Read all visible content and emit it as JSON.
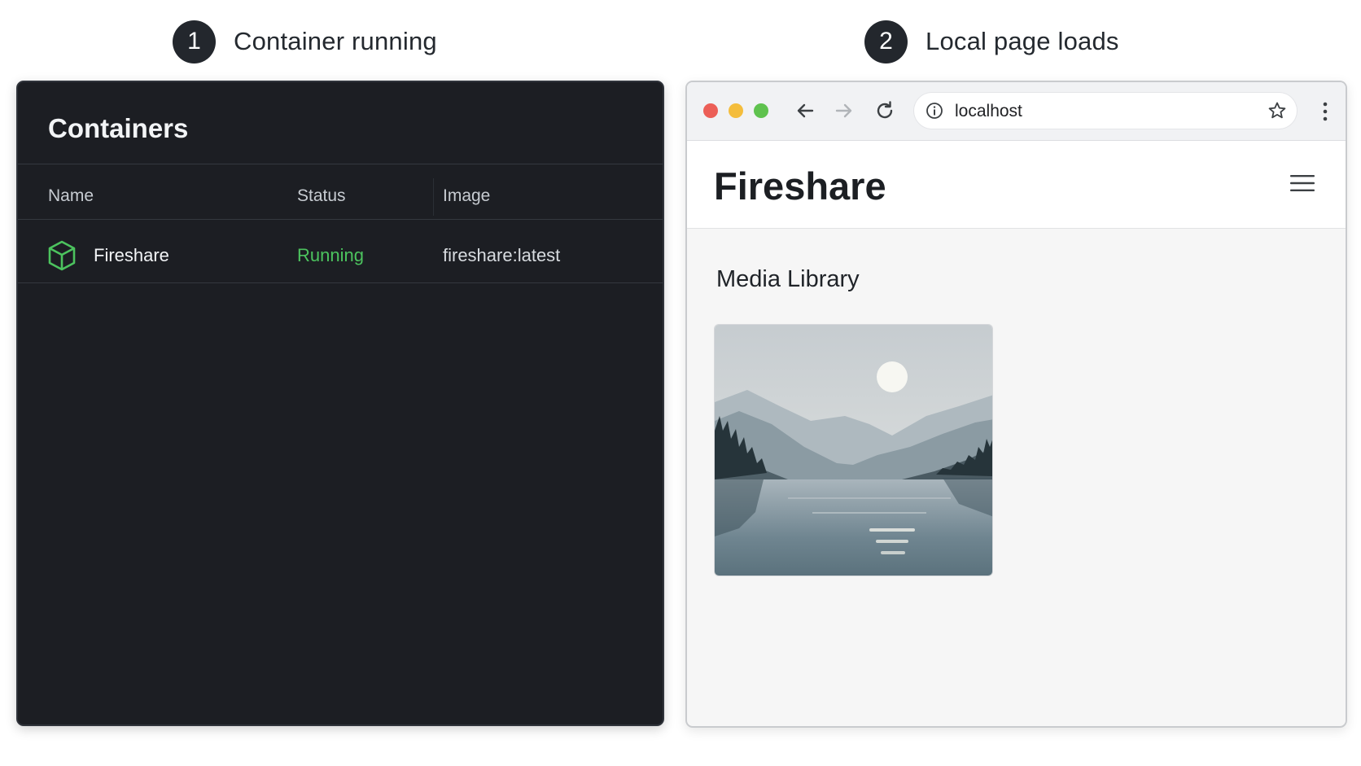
{
  "steps": [
    {
      "number": "1",
      "label": "Container running"
    },
    {
      "number": "2",
      "label": "Local page loads"
    }
  ],
  "containers_panel": {
    "title": "Containers",
    "columns": {
      "name": "Name",
      "status": "Status",
      "image": "Image"
    },
    "rows": [
      {
        "icon": "cube-icon",
        "name": "Fireshare",
        "status": "Running",
        "image": "fireshare:latest"
      }
    ],
    "colors": {
      "status_running": "#4cc35e",
      "panel_bg": "#1c1e23"
    }
  },
  "browser": {
    "url": "localhost",
    "site_title": "Fireshare",
    "section_title": "Media Library",
    "media": [
      {
        "thumbnail": "misty-lake-mountains-thumbnail"
      }
    ]
  }
}
